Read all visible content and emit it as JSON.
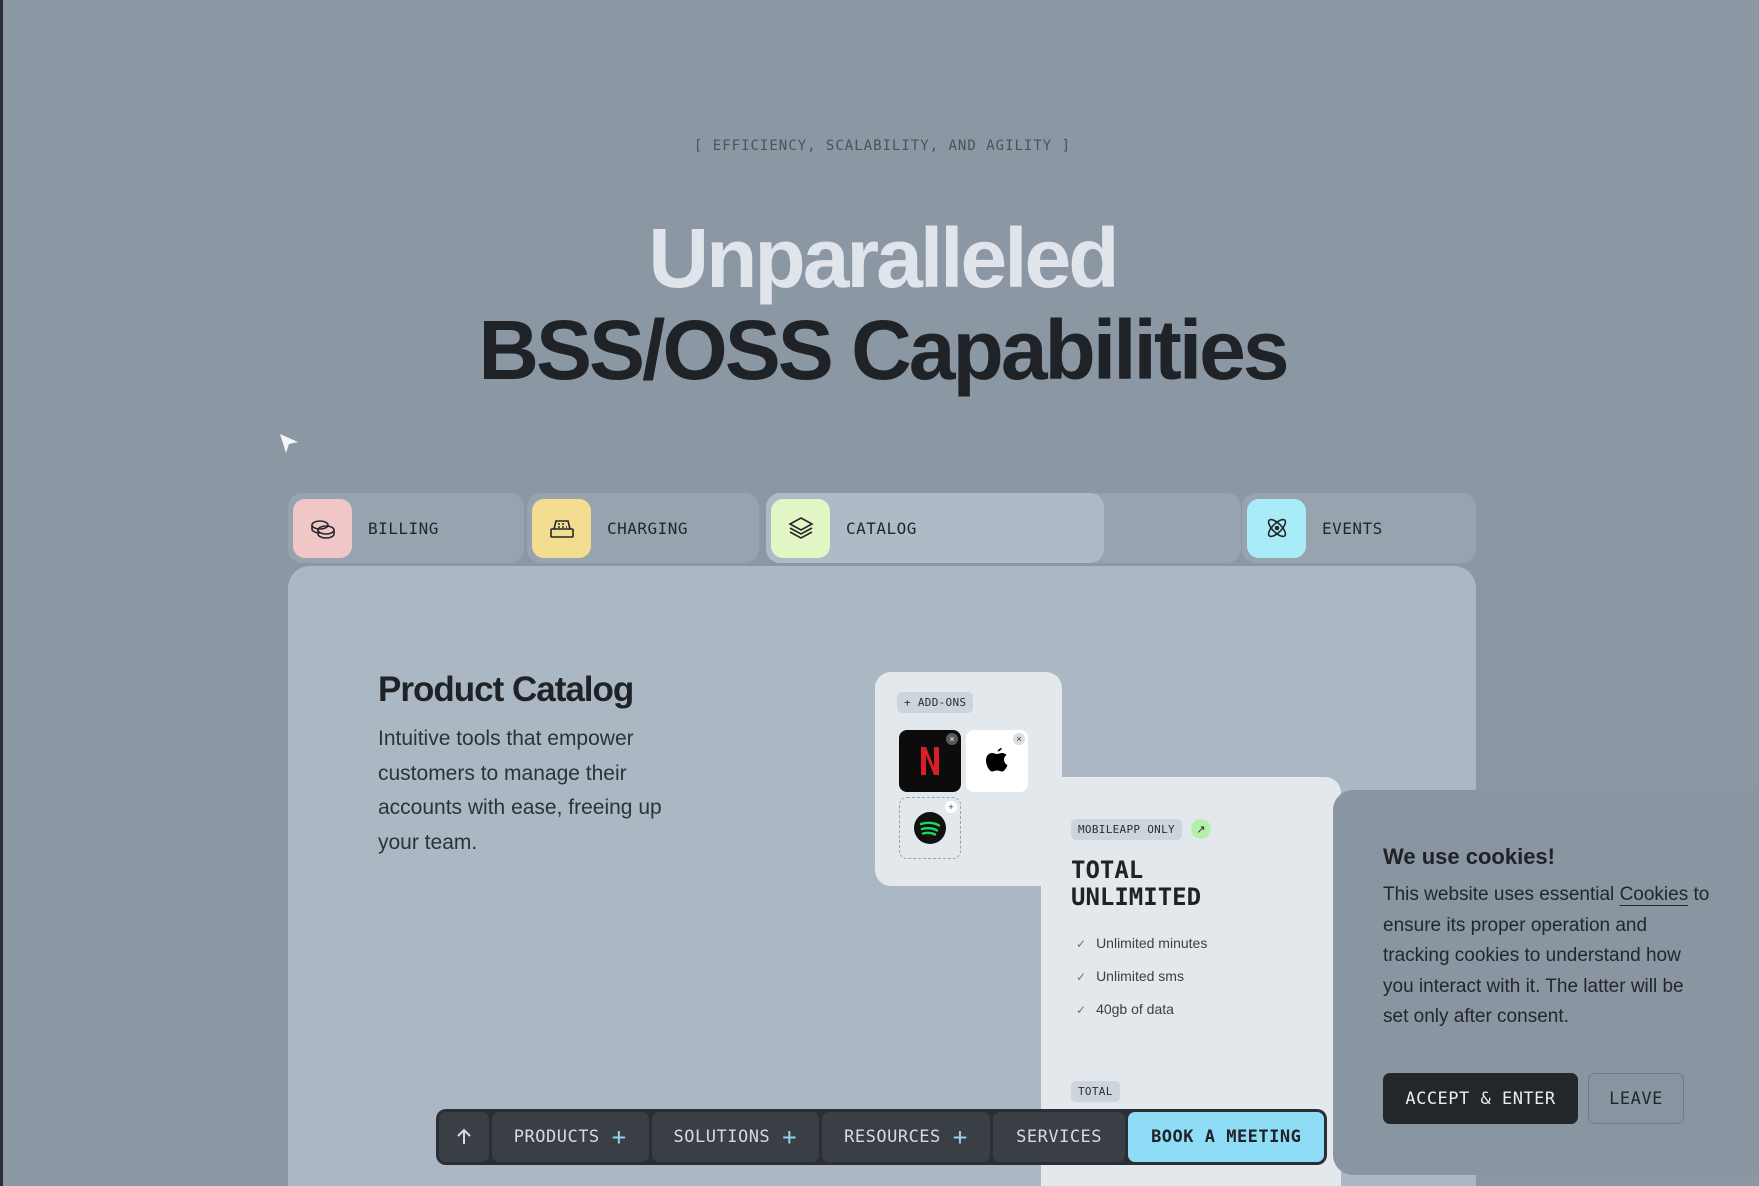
{
  "hero": {
    "eyebrow": "[ EFFICIENCY, SCALABILITY, AND AGILITY ]",
    "title_line1": "Unparalleled",
    "title_line2": "BSS/OSS Capabilities"
  },
  "tabs": [
    {
      "label": "BILLING",
      "icon": "coins-icon",
      "color": "#f1c6c6"
    },
    {
      "label": "CHARGING",
      "icon": "cash-register-icon",
      "color": "#f3dd91"
    },
    {
      "label": "CATALOG",
      "icon": "layers-icon",
      "color": "#e2f7c5",
      "active": true
    },
    {
      "label": "EVENTS",
      "icon": "atom-icon",
      "color": "#a9ebf9"
    }
  ],
  "catalog": {
    "title": "Product Catalog",
    "description": "Intuitive tools that empower customers to manage their accounts with ease, freeing up your team.",
    "addons_chip": "+ ADD-ONS",
    "addon_apps": [
      "netflix-logo",
      "apple-logo",
      "spotify-logo"
    ],
    "plan_chip": "MOBILEAPP ONLY",
    "plan_title_line1": "TOTAL",
    "plan_title_line2": "UNLIMITED",
    "features": [
      "Unlimited minutes",
      "Unlimited sms",
      "40gb of data"
    ],
    "total_chip": "TOTAL"
  },
  "cookie": {
    "title": "We use cookies!",
    "body_pre": "This website uses essential ",
    "body_link": "Cookies",
    "body_post": " to ensure its proper operation and tracking cookies to understand how you interact with it. The latter will be set only after consent.",
    "accept_label": "ACCEPT & ENTER",
    "leave_label": "LEAVE"
  },
  "nav": {
    "products": "PRODUCTS",
    "solutions": "SOLUTIONS",
    "resources": "RESOURCES",
    "services": "SERVICES",
    "book": "BOOK A MEETING"
  },
  "colors": {
    "background": "#8b97a3",
    "accent_blue": "#8fdcf7",
    "dark": "#23272b"
  }
}
